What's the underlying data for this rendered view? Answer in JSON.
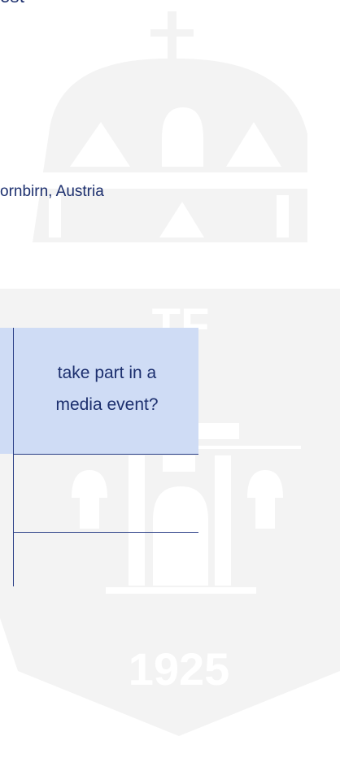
{
  "top_fragment": "est",
  "location": "ornbirn, Austria",
  "table": {
    "header_line1": "take part in a",
    "header_line2": "media event?"
  },
  "watermark": {
    "year": "1925",
    "letters": "TF"
  },
  "colors": {
    "text": "#1c2f6e",
    "header_fill": "#cfdcf5",
    "rule": "#2b3f86",
    "watermark": "#f3f3f3"
  }
}
